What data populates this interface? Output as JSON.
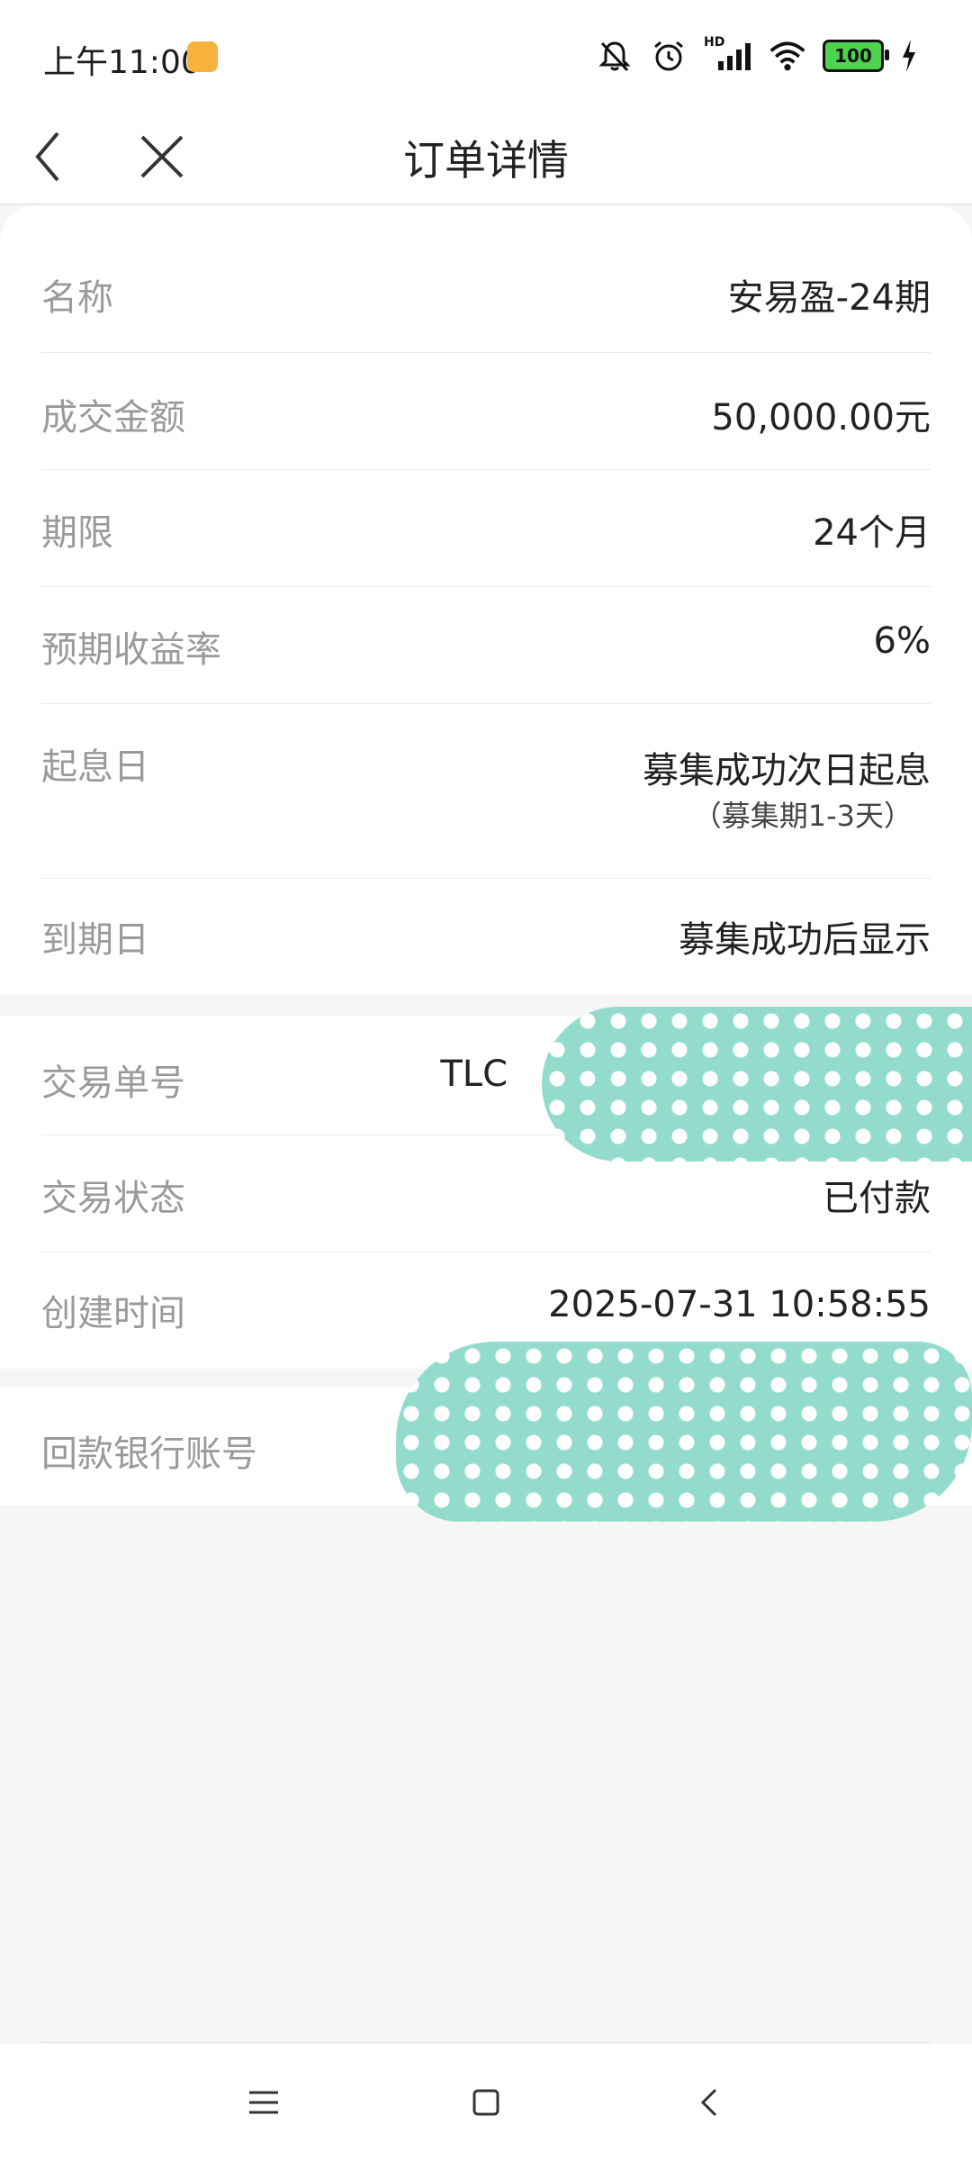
{
  "status_bar": {
    "time": "上午11:00",
    "network_label": "HD",
    "battery_level": "100",
    "icons": [
      "notification-app-icon",
      "bell-muted-icon",
      "alarm-icon",
      "signal-icon",
      "wifi-icon",
      "battery-icon",
      "charging-icon"
    ]
  },
  "nav": {
    "title": "订单详情",
    "back_icon": "chevron-left-icon",
    "close_icon": "close-icon"
  },
  "order_details": {
    "name": {
      "label": "名称",
      "value": "安易盈-24期"
    },
    "amount": {
      "label": "成交金额",
      "value": "50,000.00元"
    },
    "term": {
      "label": "期限",
      "value": "24个月"
    },
    "rate": {
      "label": "预期收益率",
      "value": "6%"
    },
    "start_date": {
      "label": "起息日",
      "value": "募集成功次日起息",
      "note": "（募集期1-3天）"
    },
    "due_date": {
      "label": "到期日",
      "value": "募集成功后显示"
    }
  },
  "transaction": {
    "number": {
      "label": "交易单号",
      "value_visible": "TLC"
    },
    "status": {
      "label": "交易状态",
      "value": "已付款"
    },
    "created": {
      "label": "创建时间",
      "value": "2025-07-31 10:58:55"
    }
  },
  "bank": {
    "account": {
      "label": "回款银行账号"
    }
  },
  "system_nav": [
    "menu-icon",
    "home-icon",
    "back-icon"
  ],
  "colors": {
    "redaction": "#93dccd",
    "label_gray": "#9a9a9a",
    "background": "#f6f6f6"
  }
}
